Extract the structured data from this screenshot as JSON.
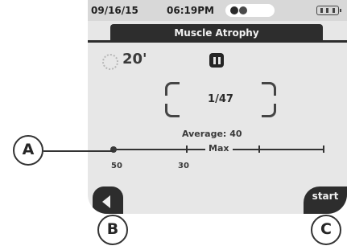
{
  "status_bar": {
    "date": "09/16/15",
    "time": "06:19PM"
  },
  "header": {
    "title": "Muscle Atrophy"
  },
  "session": {
    "timer": "20'",
    "count": "1/47",
    "average_label": "Average:",
    "average_value": "40"
  },
  "scale": {
    "label": "Max",
    "left_value": "50",
    "mid_value": "30"
  },
  "buttons": {
    "back_icon": "triangle-left",
    "start_label": "start",
    "pause_icon": "pause"
  },
  "callouts": {
    "a": "A",
    "b": "B",
    "c": "C"
  },
  "icons": {
    "timer": "dotted-circle",
    "battery": "battery",
    "status_dots": "two-dots"
  }
}
